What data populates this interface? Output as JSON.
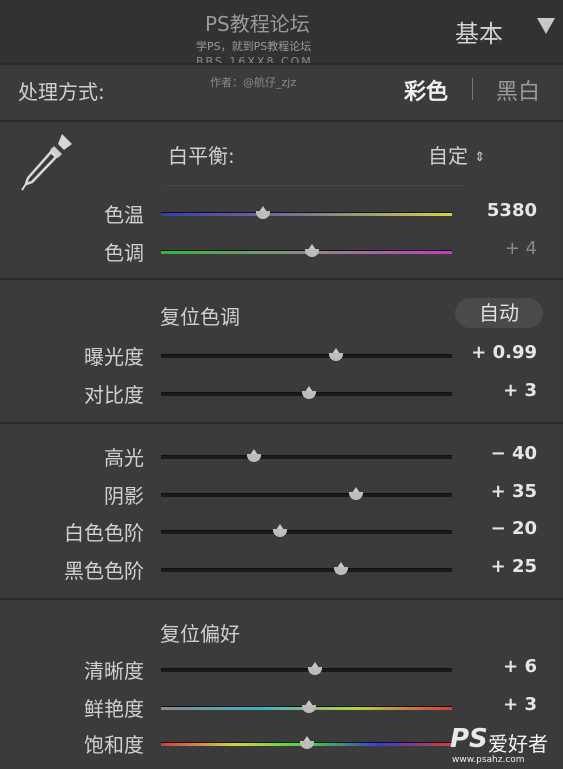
{
  "watermark": {
    "title": "PS教程论坛",
    "subtitle": "学PS，就到PS教程论坛",
    "url": "BBS.16XX8.COM",
    "author": "作者：@航仔_zjz"
  },
  "panel": {
    "title": "基本"
  },
  "treatment": {
    "label": "处理方式:",
    "color_option": "彩色",
    "bw_option": "黑白"
  },
  "white_balance": {
    "label": "白平衡:",
    "preset": "自定",
    "sliders": [
      {
        "label": "色温",
        "value": "5380",
        "level": 0.35
      },
      {
        "label": "色调",
        "value": "+ 4",
        "level": 0.52
      }
    ]
  },
  "tone": {
    "section_label": "复位色调",
    "auto_label": "自动",
    "sliders": [
      {
        "label": "曝光度",
        "value": "+ 0.99",
        "level": 0.6
      },
      {
        "label": "对比度",
        "value": "+ 3",
        "level": 0.51
      },
      {
        "label": "高光",
        "value": "− 40",
        "level": 0.32
      },
      {
        "label": "阴影",
        "value": "+ 35",
        "level": 0.67
      },
      {
        "label": "白色色阶",
        "value": "− 20",
        "level": 0.41
      },
      {
        "label": "黑色色阶",
        "value": "+ 25",
        "level": 0.62
      }
    ]
  },
  "presence": {
    "section_label": "复位偏好",
    "sliders": [
      {
        "label": "清晰度",
        "value": "+ 6",
        "level": 0.53
      },
      {
        "label": "鲜艳度",
        "value": "+ 3",
        "level": 0.51
      },
      {
        "label": "饱和度",
        "value": "",
        "level": 0.5
      }
    ]
  },
  "logo": {
    "ps": "PS",
    "cn": "爱好者",
    "url": "www.psahz.com"
  },
  "colors": {
    "background": "#3b3b3b",
    "header": "#323232",
    "thumb": "#bdbdbd"
  }
}
